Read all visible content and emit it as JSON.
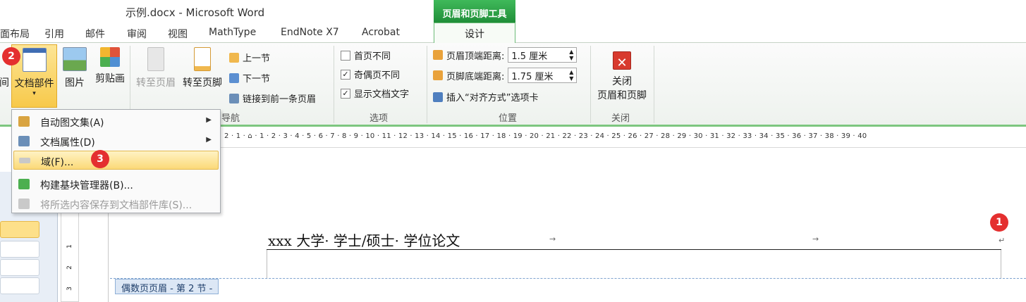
{
  "window": {
    "title": "示例.docx - Microsoft Word"
  },
  "context_tab": {
    "label": "页眉和页脚工具",
    "sub_tab": "设计"
  },
  "tabs": [
    "页面布局",
    "引用",
    "邮件",
    "审阅",
    "视图",
    "MathType",
    "EndNote X7",
    "Acrobat"
  ],
  "ribbon": {
    "insert": {
      "datetime_partial": "间",
      "doc_parts": "文档部件",
      "doc_parts_arrow": "▾",
      "picture": "图片",
      "clipart": "剪贴画"
    },
    "navigation": {
      "goto_header": "转至页眉",
      "goto_footer": "转至页脚",
      "prev_section": "上一节",
      "next_section": "下一节",
      "link_prev": "链接到前一条页眉",
      "label": "导航"
    },
    "options": {
      "different_first": {
        "label": "首页不同",
        "checked": false
      },
      "different_odd_even": {
        "label": "奇偶页不同",
        "checked": true
      },
      "show_doc_text": {
        "label": "显示文档文字",
        "checked": true
      },
      "label": "选项"
    },
    "position": {
      "header_top_label": "页眉顶端距离:",
      "header_top_value": "1.5 厘米",
      "footer_bottom_label": "页脚底端距离:",
      "footer_bottom_value": "1.75 厘米",
      "insert_align_tab": "插入“对齐方式”选项卡",
      "label": "位置"
    },
    "close": {
      "line1": "关闭",
      "line2": "页眉和页脚",
      "label": "关闭"
    }
  },
  "menu": {
    "items": [
      {
        "label": "自动图文集(A)",
        "has_sub": true,
        "disabled": false
      },
      {
        "label": "文档属性(D)",
        "has_sub": true,
        "disabled": false
      },
      {
        "label": "域(F)...",
        "has_sub": false,
        "disabled": false,
        "highlighted": true
      },
      {
        "label": "构建基块管理器(B)...",
        "has_sub": false,
        "disabled": false
      },
      {
        "label": "将所选内容保存到文档部件库(S)...",
        "has_sub": false,
        "disabled": true
      }
    ]
  },
  "ruler": {
    "numbers": "2 · 1 · ⌂ · 1 · 2 · 3 · 4 · 5 · 6 · 7 · 8 · 9 · 10 · 11 · 12 · 13 · 14 · 15 · 16 · 17 · 18 · 19 · 20 · 21 · 22 · 23 · 24 · 25 · 26 · 27 · 28 · 29 · 30 · 31 · 32 · 33 · 34 · 35 · 36 · 37 · 38 · 39 · 40"
  },
  "vruler": [
    "1",
    "2",
    "3"
  ],
  "document": {
    "header_text": "xxx 大学· 学士/硕士· 学位论文",
    "tab_mark": "→",
    "para_mark": "↵",
    "header_label": "偶数页页眉 - 第 2 节 -"
  },
  "badges": [
    "1",
    "2",
    "3"
  ],
  "colors": {
    "accent_green": "#1e8c36",
    "badge_red": "#e42f2f",
    "highlight": "#fbd978"
  }
}
